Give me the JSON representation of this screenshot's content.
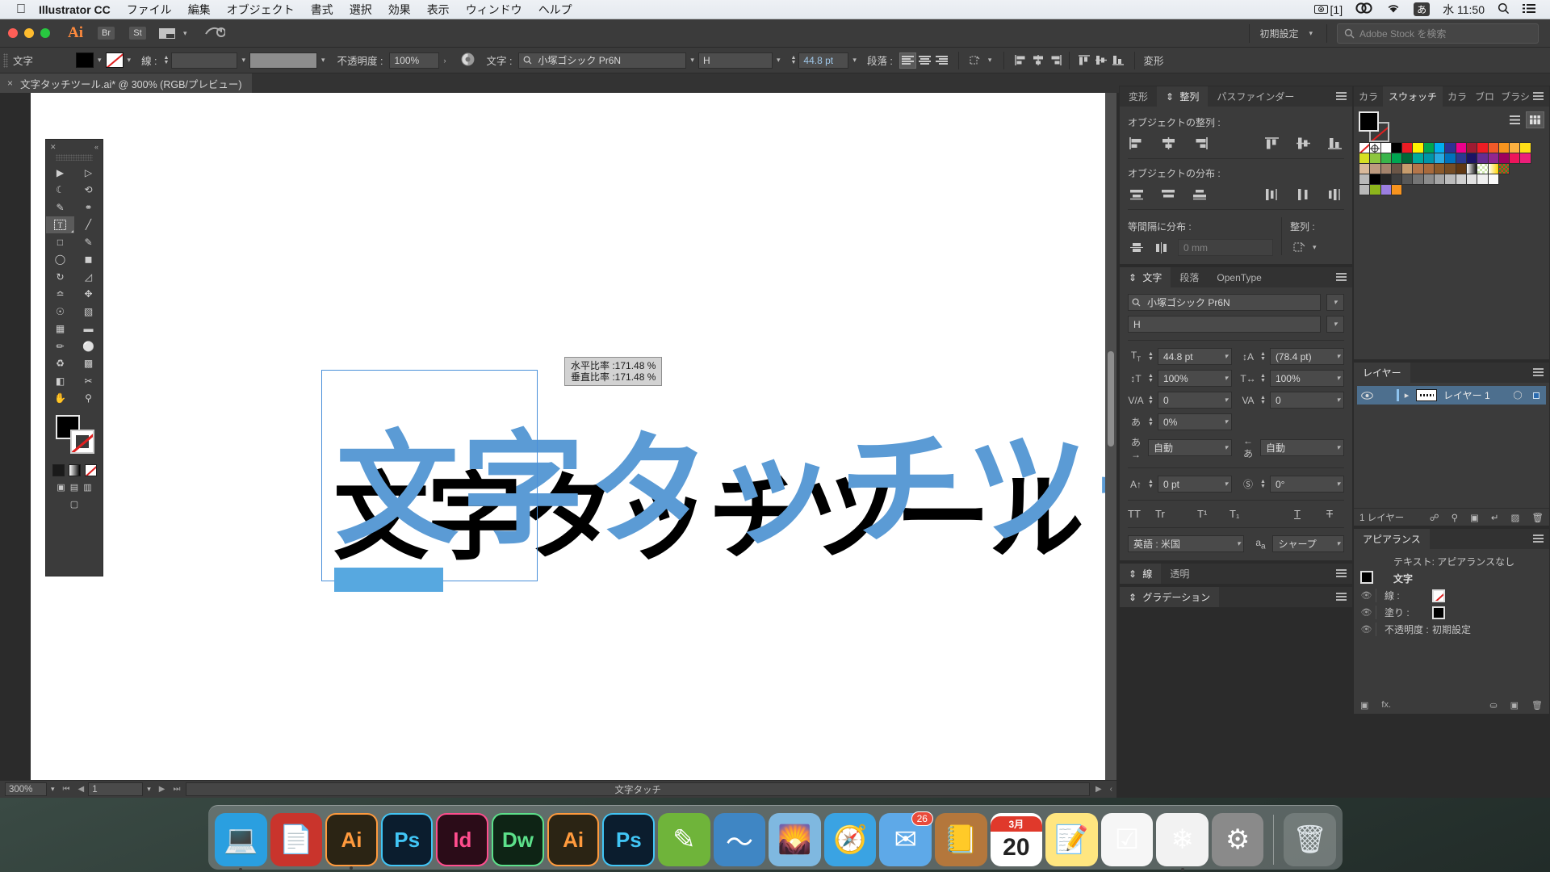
{
  "macbar": {
    "apple": "",
    "app_name": "Illustrator CC",
    "menus": [
      "ファイル",
      "編集",
      "オブジェクト",
      "書式",
      "選択",
      "効果",
      "表示",
      "ウィンドウ",
      "ヘルプ"
    ],
    "status_screenshot": "[1]",
    "status_cc": "cc-icon",
    "status_wifi": "wifi-icon",
    "status_input": "あ",
    "status_clock": "水 11:50",
    "status_search": "search-icon",
    "status_notif": "notification-center-icon"
  },
  "appbar": {
    "logo": "Ai",
    "bridge": "Br",
    "stock": "St",
    "workspace": "初期設定",
    "search_placeholder": "Adobe Stock を検索"
  },
  "control_bar": {
    "context_label": "文字",
    "stroke_label": "線 :",
    "stroke_weight": "",
    "stroke_profile": "",
    "opacity_label": "不透明度 :",
    "opacity_value": "100%",
    "font_label": "文字 :",
    "font_family": "小塚ゴシック Pr6N",
    "font_style": "H",
    "font_size": "44.8 pt",
    "paragraph_label": "段落 :",
    "transform_label": "変形"
  },
  "document_tab": {
    "close": "×",
    "title": "文字タッチツール.ai* @ 300% (RGB/プレビュー)"
  },
  "canvas": {
    "text_black": "文字タッチツール",
    "text_blue": "文字タッチツー",
    "tooltip_line1": "水平比率 :171.48 %",
    "tooltip_line2": "垂直比率 :171.48 %",
    "selection_color": "#4a90d9",
    "blue_text_color": "#5b9bd5"
  },
  "status_bar": {
    "zoom": "300%",
    "page": "1",
    "tool_name": "文字タッチ"
  },
  "align_panel": {
    "tabs": [
      "変形",
      "整列",
      "パスファインダー"
    ],
    "active_tab": "整列",
    "section_align": "オブジェクトの整列 :",
    "section_distribute": "オブジェクトの分布 :",
    "section_spacing": "等間隔に分布 :",
    "spacing_value": "0 mm",
    "align_to_label": "整列 :"
  },
  "character_panel": {
    "tabs": [
      "文字",
      "段落",
      "OpenType"
    ],
    "active_tab": "文字",
    "font_family": "小塚ゴシック Pr6N",
    "font_style": "H",
    "font_size": "44.8 pt",
    "leading": "(78.4 pt)",
    "vertical_scale": "100%",
    "horizontal_scale": "100%",
    "kerning": "0",
    "tracking": "0",
    "tsume": "0%",
    "left_aki": "自動",
    "right_aki": "自動",
    "baseline_shift": "0 pt",
    "rotation": "0°",
    "caps_buttons": [
      "TT",
      "Tr",
      "T¹",
      "T₁",
      "T",
      "T"
    ],
    "language": "英語 : 米国",
    "antialias": "シャープ"
  },
  "stroke_panel": {
    "tabs": [
      "線",
      "透明"
    ],
    "active_tab": "線"
  },
  "gradient_panel": {
    "title": "グラデーション"
  },
  "swatches_panel": {
    "tabs": [
      "カラ",
      "スウォッチ",
      "カラ",
      "ブロ",
      "ブラシ"
    ],
    "active_tab": "スウォッチ",
    "row1": [
      "none",
      "registration",
      "#ffffff",
      "#000000",
      "#ec1c24",
      "#fff200",
      "#00a650",
      "#00aeef",
      "#2e3192",
      "#ec008c",
      "#9e1b32",
      "#ed1c24",
      "#f15a29",
      "#f7941e",
      "#fbb040",
      "#ffde17"
    ],
    "row2": [
      "#d7df23",
      "#8dc63f",
      "#39b54a",
      "#00a651",
      "#006838",
      "#00a99d",
      "#0095a8",
      "#29abe2",
      "#0071bc",
      "#2b3990",
      "#1b1464",
      "#662d91",
      "#92278f",
      "#9e005d",
      "#ed145b",
      "#ec1e79"
    ],
    "row3": [
      "#d9b99b",
      "#bc9a7f",
      "#a3836c",
      "#6b5647",
      "#c69c6d",
      "#b4764a",
      "#a86a3c",
      "#8c5a2b",
      "#754c24",
      "#603813",
      "gradient-white",
      "pattern-check",
      "gradient-yellow",
      "pattern-color"
    ],
    "row4": [
      "folder",
      "#000000",
      "#262626",
      "#3f3f3f",
      "#585858",
      "#757575",
      "#8c8c8c",
      "#a5a5a5",
      "#bcbcbc",
      "#d0d0d0",
      "#e2e2e2",
      "#f0f0f0",
      "#fafafa"
    ],
    "row5": [
      "folder",
      "#8cb51c",
      "#9b7fe0",
      "#f7931e"
    ]
  },
  "layers_panel": {
    "title": "レイヤー",
    "layer_name": "レイヤー 1",
    "footer_count": "1 レイヤー",
    "footer_icons": [
      "make-clipping-mask-icon",
      "locate-object-icon",
      "new-sublayer-icon",
      "new-layer-icon",
      "duplicate-icon",
      "delete-icon"
    ]
  },
  "appearance_panel": {
    "title": "アピアランス",
    "header": "テキスト: アピアランスなし",
    "rows": [
      {
        "label": "文字",
        "value": ""
      },
      {
        "label": "線 :",
        "value": "none"
      },
      {
        "label": "塗り :",
        "value": "black"
      },
      {
        "label": "不透明度 :",
        "value": "初期設定"
      }
    ]
  },
  "tools": [
    "selection-tool",
    "direct-selection-tool",
    "magic-wand-tool",
    "lasso-tool",
    "pen-tool",
    "curvature-tool",
    "type-touch-tool",
    "line-tool",
    "rectangle-tool",
    "paintbrush-tool",
    "shaper-tool",
    "eraser-tool",
    "rotate-tool",
    "scale-tool",
    "width-tool",
    "free-transform-tool",
    "shape-builder-tool",
    "perspective-grid-tool",
    "mesh-tool",
    "gradient-tool",
    "eyedropper-tool",
    "blend-tool",
    "symbol-sprayer-tool",
    "column-graph-tool",
    "artboard-tool",
    "slice-tool",
    "hand-tool",
    "zoom-tool"
  ],
  "dock": {
    "items": [
      {
        "name": "finder",
        "label": "",
        "color": "#2a9fe0",
        "badge": ""
      },
      {
        "name": "acrobat-reader",
        "label": "",
        "color": "#c9342c",
        "badge": ""
      },
      {
        "name": "illustrator",
        "label": "Ai",
        "color": "#2b2414",
        "badge": ""
      },
      {
        "name": "photoshop",
        "label": "Ps",
        "color": "#0b1d2e",
        "badge": ""
      },
      {
        "name": "indesign",
        "label": "Id",
        "color": "#2b0c18",
        "badge": ""
      },
      {
        "name": "dreamweaver",
        "label": "Dw",
        "color": "#0e2415",
        "badge": ""
      },
      {
        "name": "illustrator-2",
        "label": "Ai",
        "color": "#2b2414",
        "badge": ""
      },
      {
        "name": "photoshop-2",
        "label": "Ps",
        "color": "#0b1d2e",
        "badge": ""
      },
      {
        "name": "sketchbook",
        "label": "",
        "color": "#6fb43a",
        "badge": ""
      },
      {
        "name": "wacom",
        "label": "",
        "color": "#3f86c4",
        "badge": ""
      },
      {
        "name": "preview",
        "label": "",
        "color": "#7fb8e0",
        "badge": ""
      },
      {
        "name": "safari",
        "label": "",
        "color": "#3aa3e3",
        "badge": ""
      },
      {
        "name": "mail",
        "label": "",
        "color": "#5ea9e8",
        "badge": "26"
      },
      {
        "name": "contacts",
        "label": "",
        "color": "#b4773c",
        "badge": ""
      },
      {
        "name": "calendar",
        "label": "20",
        "color": "#ffffff",
        "badge": ""
      },
      {
        "name": "notes",
        "label": "",
        "color": "#ffe680",
        "badge": ""
      },
      {
        "name": "reminders",
        "label": "",
        "color": "#f6f6f6",
        "badge": ""
      },
      {
        "name": "photos",
        "label": "",
        "color": "#f2f2f2",
        "badge": ""
      },
      {
        "name": "system-preferences",
        "label": "",
        "color": "#8a8a8a",
        "badge": ""
      },
      {
        "name": "trash",
        "label": "",
        "color": "#cfd6d9",
        "badge": ""
      }
    ],
    "calendar_month": "3月",
    "calendar_day": "20"
  }
}
